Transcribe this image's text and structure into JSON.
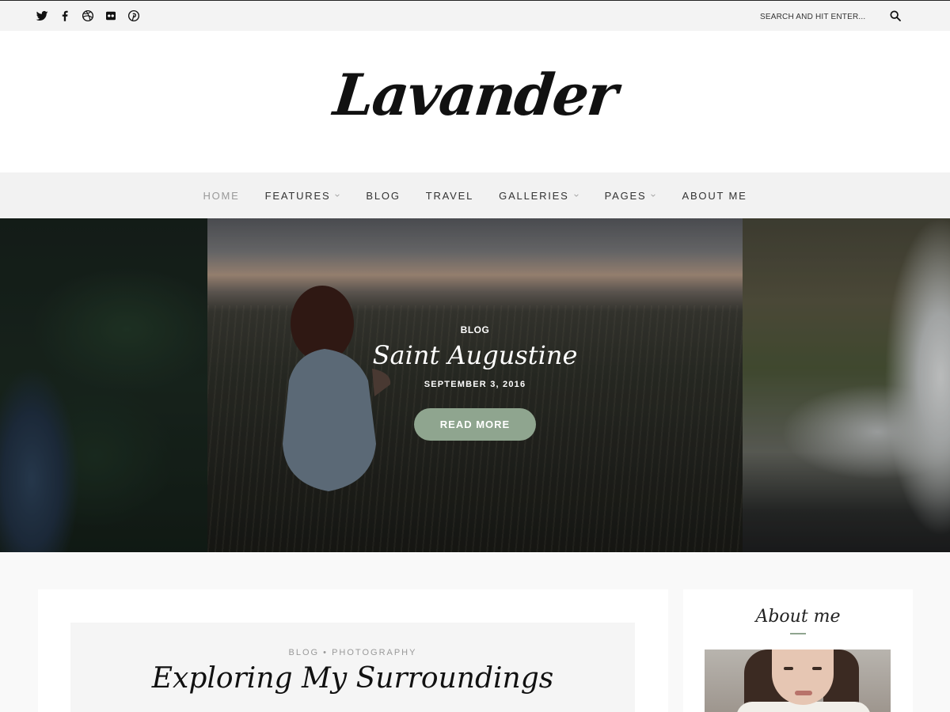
{
  "topbar": {
    "social_icons": [
      "twitter-icon",
      "facebook-icon",
      "dribbble-icon",
      "flickr-icon",
      "pinterest-icon"
    ],
    "search": {
      "placeholder": "SEARCH AND HIT ENTER...",
      "value": ""
    }
  },
  "logo": {
    "text": "Lavander"
  },
  "nav": {
    "items": [
      {
        "label": "HOME",
        "active": true,
        "has_dropdown": false
      },
      {
        "label": "FEATURES",
        "has_dropdown": true
      },
      {
        "label": "BLOG",
        "has_dropdown": false
      },
      {
        "label": "TRAVEL",
        "has_dropdown": false
      },
      {
        "label": "GALLERIES",
        "has_dropdown": true
      },
      {
        "label": "PAGES",
        "has_dropdown": true
      },
      {
        "label": "ABOUT ME",
        "has_dropdown": false
      }
    ]
  },
  "slider": {
    "category": "BLOG",
    "title": "Saint Augustine",
    "date": "SEPTEMBER 3, 2016",
    "button": "READ MORE"
  },
  "post": {
    "categories": [
      "BLOG",
      "PHOTOGRAPHY"
    ],
    "separator": "•",
    "title": "Exploring My Surroundings"
  },
  "sidebar": {
    "widget_title": "About me"
  },
  "colors": {
    "accent": "#8fa58f",
    "topbar_bg": "#f3f3f3",
    "nav_bg": "#f2f2f2",
    "page_bg": "#f9f9f9"
  }
}
